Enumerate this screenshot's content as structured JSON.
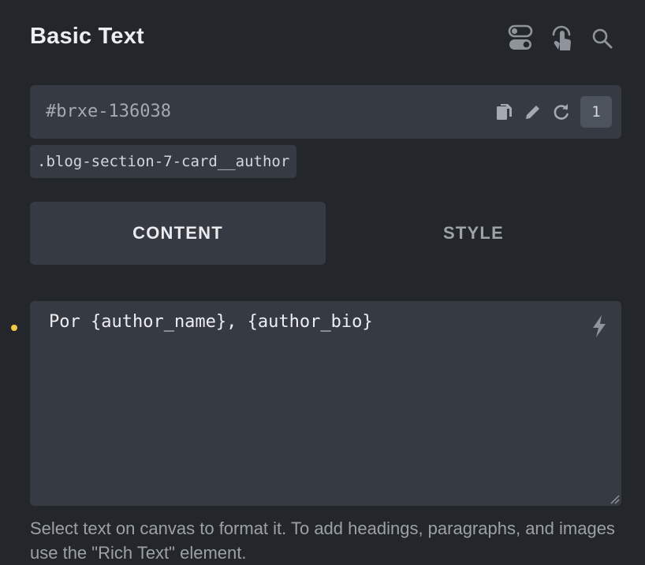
{
  "panel": {
    "title": "Basic Text",
    "header_icons": [
      "toggle-icon",
      "touch-icon",
      "search-icon"
    ]
  },
  "element": {
    "id": "#brxe-136038",
    "count": "1",
    "actions": [
      "copy-icon",
      "pencil-icon",
      "refresh-icon"
    ],
    "class_name": ".blog-section-7-card__author"
  },
  "tabs": [
    {
      "label": "CONTENT",
      "active": true
    },
    {
      "label": "STYLE",
      "active": false
    }
  ],
  "text_field": {
    "value": "Por {author_name}, {author_bio}",
    "indicator_color": "#f3c944",
    "dynamic_icon": "lightning-icon"
  },
  "help_text": "Select text on canvas to format it. To add headings, paragraphs, and images use the \"Rich Text\" element."
}
